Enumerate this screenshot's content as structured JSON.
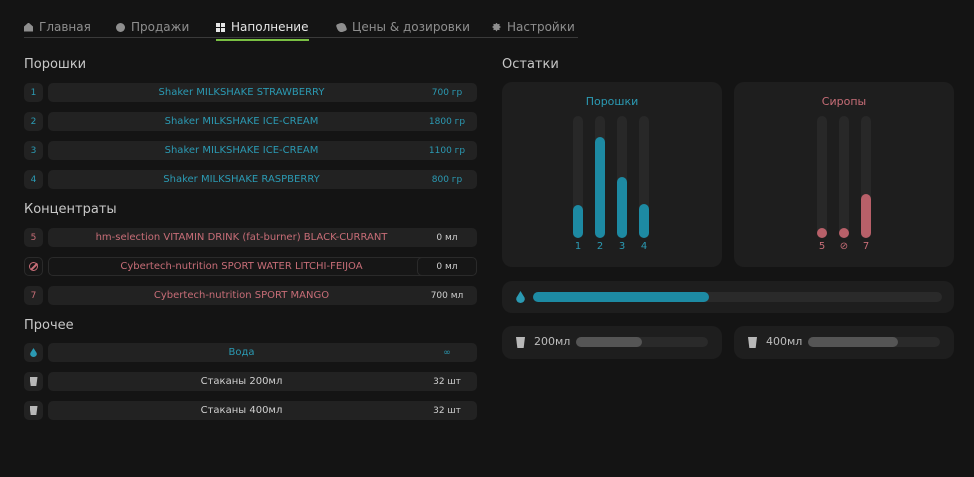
{
  "tabs": [
    {
      "label": "Главная",
      "icon": "home-icon"
    },
    {
      "label": "Продажи",
      "icon": "info-icon"
    },
    {
      "label": "Наполнение",
      "icon": "grid-icon",
      "active": true
    },
    {
      "label": "Цены & дозировки",
      "icon": "tag-icon"
    },
    {
      "label": "Настройки",
      "icon": "gear-icon"
    }
  ],
  "sections": {
    "powders": "Порошки",
    "concentrates": "Концентраты",
    "other": "Прочее",
    "remains": "Остатки"
  },
  "powders": [
    {
      "num": "1",
      "name": "Shaker MILKSHAKE STRAWBERRY",
      "qty": "700 гр"
    },
    {
      "num": "2",
      "name": "Shaker MILKSHAKE ICE-CREAM",
      "qty": "1800 гр"
    },
    {
      "num": "3",
      "name": "Shaker MILKSHAKE ICE-CREAM",
      "qty": "1100 гр"
    },
    {
      "num": "4",
      "name": "Shaker MILKSHAKE RASPBERRY",
      "qty": "800 гр"
    }
  ],
  "concentrates": [
    {
      "num": "5",
      "name": "hm-selection  VITAMIN DRINK (fat-burner)  BLACK-CURRANT",
      "qty": "0 мл"
    },
    {
      "num": "",
      "icon": "ban-icon",
      "name": "Cybertech-nutrition  SPORT WATER  LITCHI-FEIJOA",
      "qty": "0 мл"
    },
    {
      "num": "7",
      "name": "Cybertech-nutrition  SPORT MANGO",
      "qty": "700 мл"
    }
  ],
  "other": [
    {
      "icon": "water-drop-icon",
      "name": "Вода",
      "qty": "∞"
    },
    {
      "icon": "cup-icon",
      "name": "Стаканы 200мл",
      "qty": "32 шт"
    },
    {
      "icon": "cup-icon",
      "name": "Стаканы 400мл",
      "qty": "32 шт"
    }
  ],
  "remains": {
    "powders_panel": {
      "title": "Порошки",
      "bars": [
        {
          "label": "1",
          "level": 0.27
        },
        {
          "label": "2",
          "level": 0.83
        },
        {
          "label": "3",
          "level": 0.5
        },
        {
          "label": "4",
          "level": 0.28
        }
      ]
    },
    "syrups_panel": {
      "title": "Сиропы",
      "bars": [
        {
          "label": "5",
          "level": 0.0
        },
        {
          "label": "⊘",
          "level": 0.0
        },
        {
          "label": "7",
          "level": 0.36
        }
      ]
    },
    "water": {
      "icon": "water-drop-icon",
      "level": 0.43
    },
    "cups": [
      {
        "label": "200мл",
        "icon": "cup-icon",
        "level": 0.5
      },
      {
        "label": "400мл",
        "icon": "cup-icon",
        "level": 0.68
      }
    ]
  },
  "colors": {
    "powder": "#1d8aa3",
    "syrup": "#b86069",
    "cup": "#555555",
    "accent": "#7ac043"
  }
}
